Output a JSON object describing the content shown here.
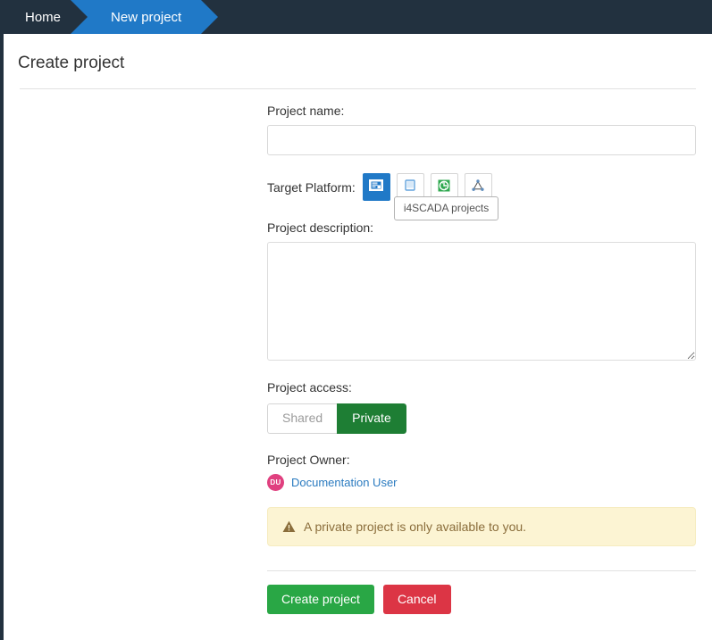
{
  "topbar": {
    "home_label": "Home",
    "active_crumb_label": "New project",
    "bg_color": "#22313f",
    "active_color": "#2079c7"
  },
  "page": {
    "title": "Create project"
  },
  "form": {
    "project_name": {
      "label": "Project name:",
      "value": "",
      "placeholder": ""
    },
    "target_platform": {
      "label": "Target Platform:",
      "options": [
        {
          "name": "i4scada-projects",
          "icon": "scada-screen-icon",
          "selected": true
        },
        {
          "name": "tablet-projects",
          "icon": "tablet-icon",
          "selected": false
        },
        {
          "name": "energy-projects",
          "icon": "recycle-green-icon",
          "selected": false
        },
        {
          "name": "topology-projects",
          "icon": "node-network-icon",
          "selected": false
        }
      ],
      "tooltip": "i4SCADA projects"
    },
    "project_description": {
      "label": "Project description:",
      "value": "",
      "placeholder": ""
    },
    "project_access": {
      "label": "Project access:",
      "options": [
        "Shared",
        "Private"
      ],
      "selected": "Private",
      "active_color": "#1e7e34"
    },
    "project_owner": {
      "label": "Project Owner:",
      "avatar_initials": "DU",
      "avatar_color": "#e0407f",
      "name": "Documentation User"
    },
    "alert": {
      "icon": "warning-triangle-icon",
      "message": "A private project is only available to you.",
      "bg_color": "#fcf4d3",
      "text_color": "#8a6d3b"
    },
    "actions": {
      "create_label": "Create project",
      "create_color": "#29a745",
      "cancel_label": "Cancel",
      "cancel_color": "#dc3545"
    }
  }
}
